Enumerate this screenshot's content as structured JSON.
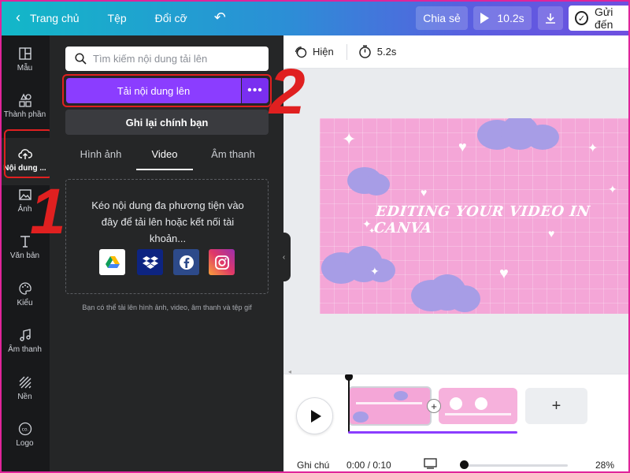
{
  "topbar": {
    "home": "Trang chủ",
    "file": "Tệp",
    "resize": "Đổi cỡ",
    "share": "Chia sẻ",
    "play_duration": "10.2s",
    "send": "Gửi đến"
  },
  "rail": [
    {
      "label": "Mẫu",
      "icon": "template-icon"
    },
    {
      "label": "Thành phần",
      "icon": "elements-icon"
    },
    {
      "label": "Nội dung ...",
      "icon": "upload-cloud-icon"
    },
    {
      "label": "Ảnh",
      "icon": "photo-icon"
    },
    {
      "label": "Văn bản",
      "icon": "text-icon"
    },
    {
      "label": "Kiểu",
      "icon": "palette-icon"
    },
    {
      "label": "Âm thanh",
      "icon": "music-icon"
    },
    {
      "label": "Nền",
      "icon": "background-icon"
    },
    {
      "label": "Logo",
      "icon": "logo-icon"
    }
  ],
  "panel": {
    "search_placeholder": "Tìm kiếm nội dung tải lên",
    "upload_button": "Tải nội dung lên",
    "more_button": "•••",
    "record_button": "Ghi lại chính bạn",
    "tabs": [
      "Hình ảnh",
      "Video",
      "Âm thanh"
    ],
    "active_tab": "Video",
    "drop_text": "Kéo nội dung đa phương tiện vào đây để tải lên hoặc kết nối tài khoản...",
    "sources": [
      "google-drive-icon",
      "dropbox-icon",
      "facebook-icon",
      "instagram-icon"
    ],
    "hint": "Bạn có thể tải lên hình ảnh, video, âm thanh và tệp gif"
  },
  "annotations": {
    "one": "1",
    "two": "2"
  },
  "editor_toolbar": {
    "show": "Hiện",
    "duration": "5.2s"
  },
  "canvas": {
    "title": "EDITING YOUR VIDEO IN CANVA"
  },
  "timeline": {
    "notes": "Ghi chú",
    "time": "0:00 / 0:10",
    "zoom": "28%",
    "zoom_level": 0.28
  },
  "colors": {
    "accent": "#8b3dff",
    "annotation": "#e02020",
    "canvas_bg": "#f4a6d7",
    "cloud": "#a79de6"
  }
}
